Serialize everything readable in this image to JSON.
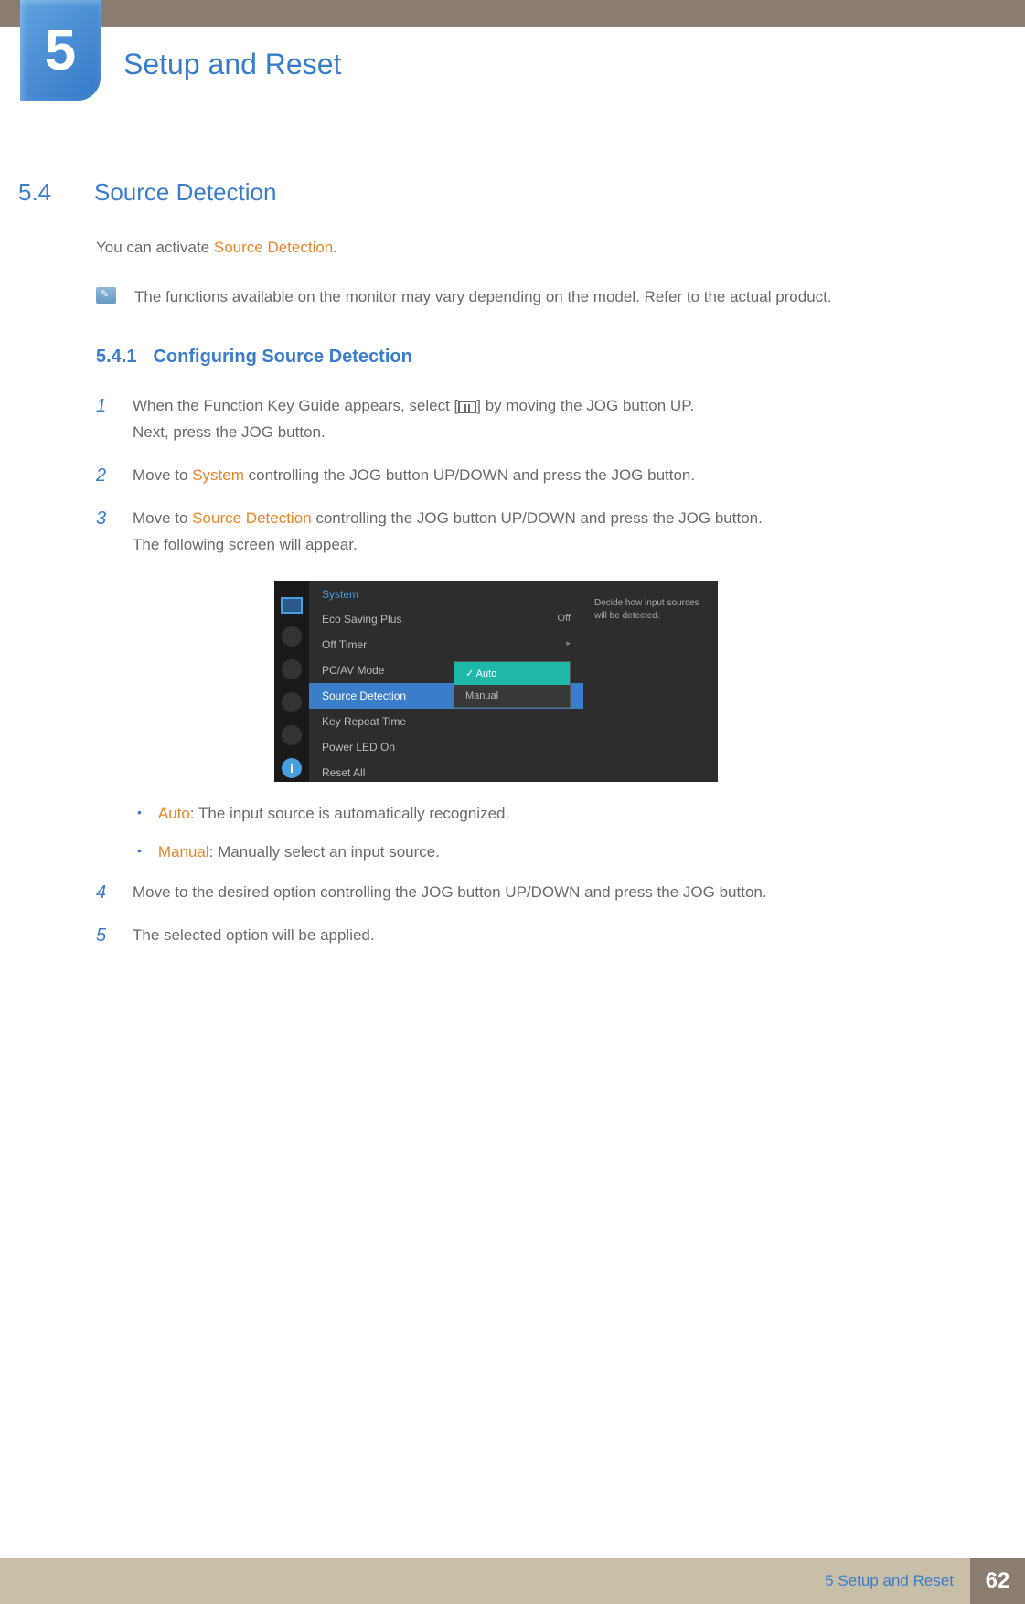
{
  "chapter": {
    "number": "5",
    "title": "Setup and Reset"
  },
  "section": {
    "number": "5.4",
    "title": "Source Detection"
  },
  "intro": {
    "pre": "You can activate ",
    "highlight": "Source Detection",
    "post": "."
  },
  "note": "The functions available on the monitor may vary depending on the model. Refer to the actual product.",
  "subsection": {
    "number": "5.4.1",
    "title": "Configuring Source Detection"
  },
  "steps": {
    "s1": {
      "num": "1",
      "line1a": "When the Function Key Guide appears, select [",
      "line1b": "] by moving the JOG button UP.",
      "line2": "Next, press the JOG button."
    },
    "s2": {
      "num": "2",
      "pre": "Move to ",
      "hl": "System",
      "post": " controlling the JOG button UP/DOWN and press the JOG button."
    },
    "s3": {
      "num": "3",
      "pre": "Move to ",
      "hl": "Source Detection",
      "post": " controlling the JOG button UP/DOWN and press the JOG button.",
      "line2": "The following screen will appear."
    },
    "s4": {
      "num": "4",
      "text": "Move to the desired option controlling the JOG button UP/DOWN and press the JOG button."
    },
    "s5": {
      "num": "5",
      "text": "The selected option will be applied."
    }
  },
  "osd": {
    "header": "System",
    "items": {
      "i1": {
        "label": "Eco Saving Plus",
        "val": "Off"
      },
      "i2": {
        "label": "Off Timer",
        "arrow": "▸"
      },
      "i3": {
        "label": "PC/AV Mode"
      },
      "i4": {
        "label": "Source Detection"
      },
      "i5": {
        "label": "Key Repeat Time"
      },
      "i6": {
        "label": "Power LED On"
      },
      "i7": {
        "label": "Reset All"
      }
    },
    "popup": {
      "opt1": "Auto",
      "opt2": "Manual"
    },
    "info": "Decide how input sources will be detected."
  },
  "bullets": {
    "b1": {
      "hl": "Auto",
      "text": ": The input source is automatically recognized."
    },
    "b2": {
      "hl": "Manual",
      "text": ": Manually select an input source."
    }
  },
  "footer": {
    "text": "5 Setup and Reset",
    "page": "62"
  }
}
